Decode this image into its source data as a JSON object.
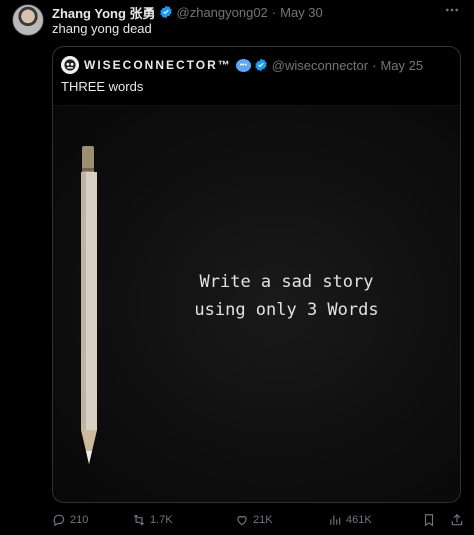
{
  "tweet": {
    "author_name": "Zhang Yong 张勇",
    "handle": "@zhangyong02",
    "separator": "·",
    "date": "May 30",
    "text": "zhang yong dead",
    "more_icon": "ellipsis-icon"
  },
  "quote": {
    "author_name": "WISECONNECTOR™",
    "handle": "@wiseconnector",
    "separator": "·",
    "date": "May 25",
    "text": "THREE words",
    "media_caption_line1": "Write a sad story",
    "media_caption_line2": "using only 3 Words"
  },
  "actions": {
    "replies": "210",
    "reposts": "1.7K",
    "likes": "21K",
    "views": "461K"
  },
  "colors": {
    "background": "#000000",
    "text": "#e7e9ea",
    "muted": "#71767b",
    "verified": "#1d9bf0",
    "border": "#2f3336"
  }
}
